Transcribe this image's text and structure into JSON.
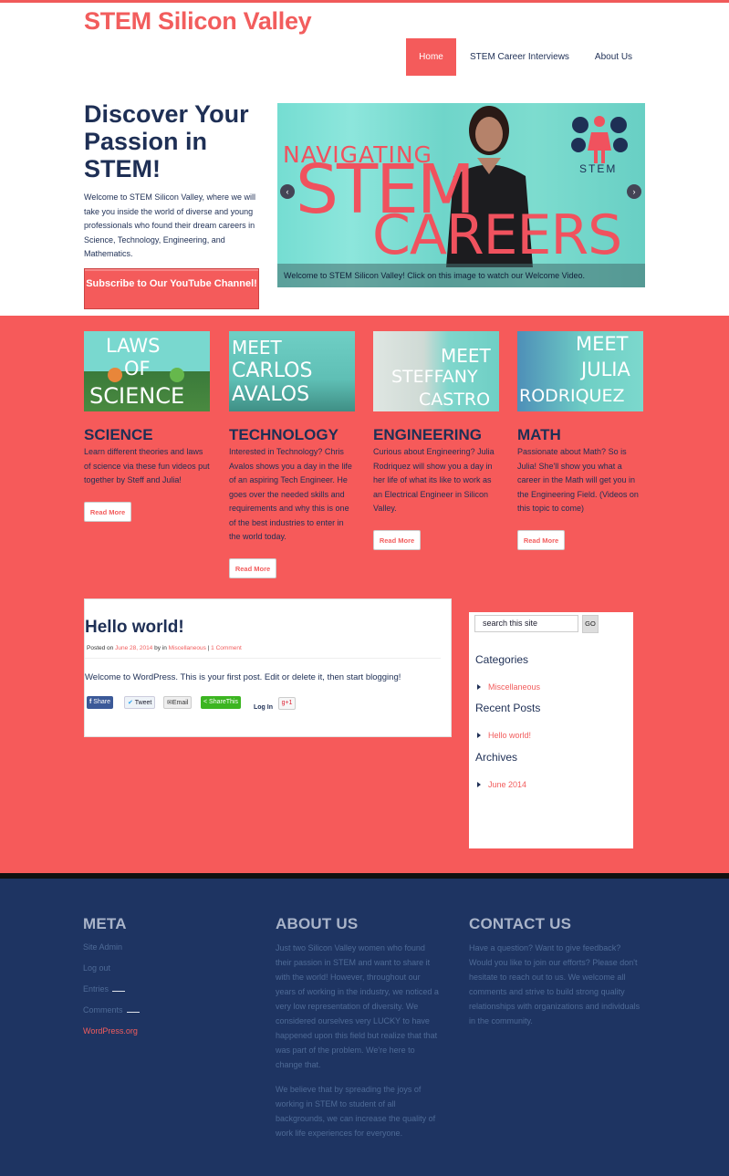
{
  "site": {
    "title": "STEM Silicon Valley"
  },
  "nav": {
    "items": [
      "Home",
      "STEM Career Interviews",
      "About Us"
    ]
  },
  "hero": {
    "title": "Discover Your Passion in STEM!",
    "text": "Welcome to STEM Silicon Valley, where we will take you inside the world of diverse and young professionals who found their dream careers in Science, Technology, Engineering, and Mathematics.",
    "subscribe": "Subscribe to Our YouTube Channel!"
  },
  "slider": {
    "heading_line1": "NAVIGATING",
    "heading_line2": "STEM",
    "heading_line3": "CAREERS",
    "logo_label": "STEM",
    "caption": "Welcome to STEM Silicon Valley! Click on this image to watch our Welcome Video.",
    "prev": "‹",
    "next": "›"
  },
  "cards": [
    {
      "thumb": "LAWS\nOF\nSCIENCE",
      "title": "SCIENCE",
      "text": "Learn different theories and laws of science via these fun videos put together by Steff and Julia!",
      "button": "Read More"
    },
    {
      "thumb": "MEET\nCARLOS\nAVALOS",
      "title": "TECHNOLOGY",
      "text": "Interested in Technology? Chris Avalos shows you a day in the life of an aspiring Tech Engineer. He goes over the needed skills and requirements and why this is one of the best industries to enter in the world today.",
      "button": "Read More"
    },
    {
      "thumb": "MEET\nSTEFFANY\nCASTRO",
      "title": "ENGINEERING",
      "text": "Curious about Engineering? Julia Rodriquez will show you a day in her life of what its like to work as an Electrical Engineer in Silicon Valley.",
      "button": "Read More"
    },
    {
      "thumb": "MEET\nJULIA\nRODRIQUEZ",
      "title": "MATH",
      "text": "Passionate about Math? So is Julia! She'll show you what a career in the Math will get you in the Engineering Field. (Videos on this topic to come)",
      "button": "Read More"
    }
  ],
  "post": {
    "title": "Hello world!",
    "meta_posted": "Posted on",
    "meta_date": "June 28, 2014",
    "meta_by": "by  in",
    "meta_cat": "Miscellaneous",
    "meta_sep": "|",
    "meta_comments": "1 Comment",
    "body": "Welcome to WordPress. This is your first post. Edit or delete it, then start blogging!",
    "share": {
      "facebook": "Share",
      "twitter": "Tweet",
      "email": "Email",
      "sharethis": "ShareThis",
      "login": "Log In",
      "gplus": "g+1"
    }
  },
  "sidebar": {
    "search_placeholder": "search this site",
    "go": "GO",
    "categories_title": "Categories",
    "categories": [
      "Miscellaneous"
    ],
    "recent_title": "Recent Posts",
    "recent": [
      "Hello world!"
    ],
    "archives_title": "Archives",
    "archives": [
      "June 2014"
    ]
  },
  "footer": {
    "meta_title": "META",
    "meta_items": [
      "Site Admin",
      "Log out",
      "Entries",
      "Comments",
      "WordPress.org"
    ],
    "about_title": "ABOUT US",
    "about_p1": "Just two Silicon Valley women who found their passion in STEM and want to share it with the world! However, throughout our years of working in the industry, we noticed a very low representation of diversity. We considered ourselves very LUCKY to have happened upon this field but realize that that was part of the problem. We're here to change that.",
    "about_p2": "We believe that by spreading the joys of working in STEM to student of all backgrounds, we can increase the quality of work life experiences for everyone.",
    "contact_title": "CONTACT US",
    "contact_text": "Have a question? Want to give feedback? Would you like to join our efforts? Please don't hesitate to reach out to us. We welcome all comments and strive to build strong quality relationships with organizations and individuals in the community."
  }
}
